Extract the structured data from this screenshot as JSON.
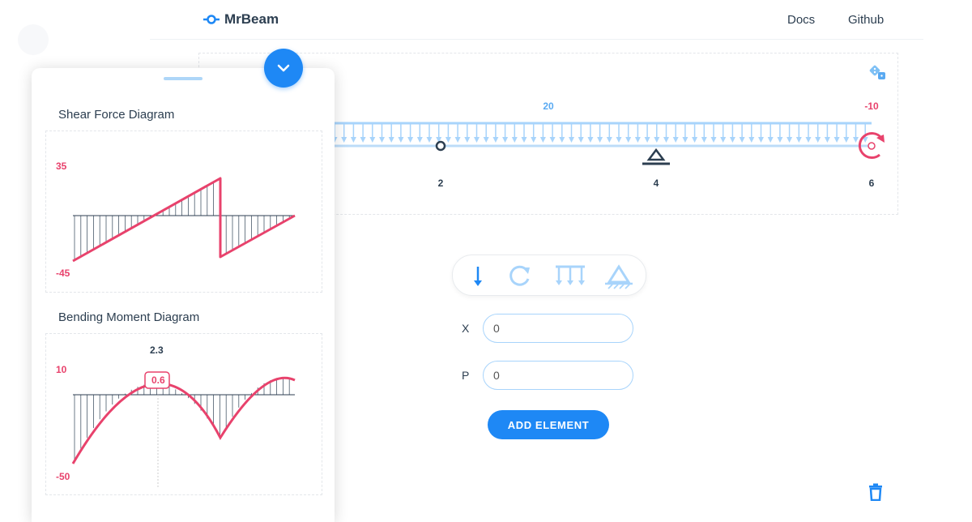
{
  "app": {
    "name": "MrBeam"
  },
  "nav": {
    "docs": "Docs",
    "github": "Github"
  },
  "beam": {
    "load_label": "20",
    "moment_label": "-10",
    "positions": [
      "2",
      "4",
      "6"
    ]
  },
  "tools": {
    "point_load": "point-load-icon",
    "moment": "moment-icon",
    "distributed_load": "distributed-load-icon",
    "support": "support-icon"
  },
  "form": {
    "x_label": "X",
    "x_value": "0",
    "p_label": "P",
    "p_value": "0",
    "add_button": "ADD ELEMENT"
  },
  "drawer": {
    "shear_title": "Shear Force Diagram",
    "shear_max": "35",
    "shear_min": "-45",
    "moment_title": "Bending Moment Diagram",
    "moment_max": "10",
    "moment_min": "-50",
    "moment_x_label": "2.3",
    "moment_peak_label": "0.6"
  },
  "colors": {
    "accent": "#1e88f5",
    "load": "#5aaaf2",
    "diagram": "#e8426c",
    "text": "#2c3e50"
  }
}
